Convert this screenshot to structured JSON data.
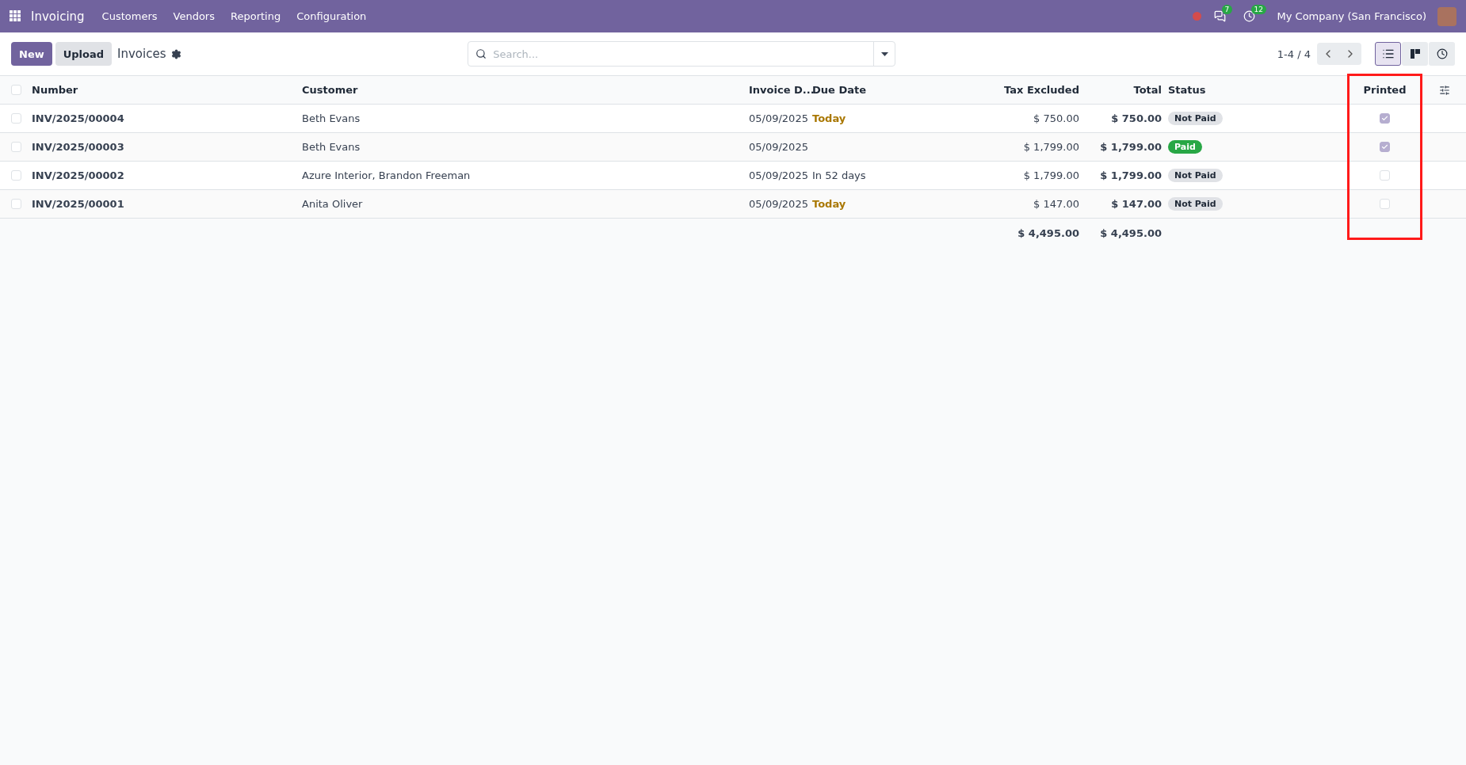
{
  "navbar": {
    "app": "Invoicing",
    "menu": [
      "Customers",
      "Vendors",
      "Reporting",
      "Configuration"
    ],
    "messages_count": "7",
    "activities_count": "12",
    "company": "My Company (San Francisco)"
  },
  "control_panel": {
    "buttons": [
      {
        "label": "New",
        "kind": "primary"
      },
      {
        "label": "Upload",
        "kind": "secondary"
      }
    ],
    "title": "Invoices",
    "search": {
      "placeholder": "Search..."
    },
    "pager": "1-4 / 4",
    "views": [
      {
        "kind": "list",
        "selected": true
      },
      {
        "kind": "kanban",
        "selected": false
      },
      {
        "kind": "activity",
        "selected": false
      }
    ]
  },
  "table": {
    "select_all_checked": false,
    "columns": [
      {
        "label": "Number",
        "highlighted": false
      },
      {
        "label": "Customer",
        "highlighted": false
      },
      {
        "label": "Invoice D...",
        "highlighted": false
      },
      {
        "label": "Due Date",
        "highlighted": false
      },
      {
        "label": "Tax Excluded",
        "highlighted": false
      },
      {
        "label": "Total",
        "highlighted": false
      },
      {
        "label": "Status",
        "highlighted": false
      },
      {
        "label": "Printed",
        "highlighted": true
      }
    ],
    "rows": [
      {
        "checked": false,
        "number": "INV/2025/00004",
        "customer": "Beth Evans",
        "invoice_date": "05/09/2025",
        "due_date": "Today",
        "due_warning": true,
        "tax_excluded": "$ 750.00",
        "total": "$ 750.00",
        "status": "Not Paid",
        "paid": false,
        "printed": true
      },
      {
        "checked": false,
        "number": "INV/2025/00003",
        "customer": "Beth Evans",
        "invoice_date": "05/09/2025",
        "due_date": "",
        "tax_excluded": "$ 1,799.00",
        "total": "$ 1,799.00",
        "status": "Paid",
        "paid": true,
        "printed": true
      },
      {
        "checked": false,
        "number": "INV/2025/00002",
        "customer": "Azure Interior, Brandon Freeman",
        "invoice_date": "05/09/2025",
        "due_date": "In 52 days",
        "due_warning": false,
        "tax_excluded": "$ 1,799.00",
        "total": "$ 1,799.00",
        "status": "Not Paid",
        "paid": false,
        "printed": false
      },
      {
        "checked": false,
        "number": "INV/2025/00001",
        "customer": "Anita Oliver",
        "invoice_date": "05/09/2025",
        "due_date": "Today",
        "due_warning": true,
        "tax_excluded": "$ 147.00",
        "total": "$ 147.00",
        "status": "Not Paid",
        "paid": false,
        "printed": false
      }
    ],
    "totals": {
      "tax_excluded": "$ 4,495.00",
      "total": "$ 4,495.00"
    }
  }
}
